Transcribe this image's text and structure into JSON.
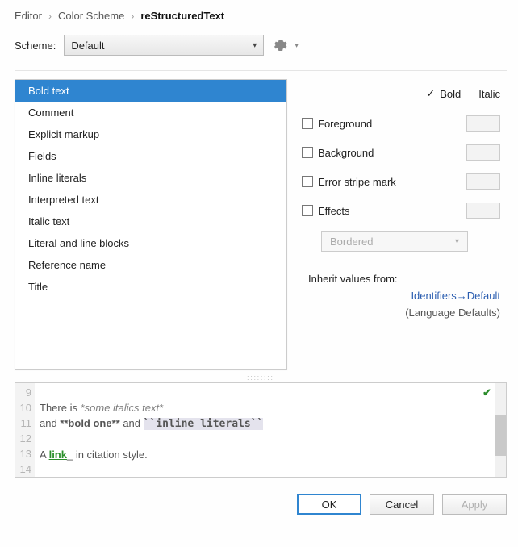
{
  "breadcrumb": {
    "a": "Editor",
    "b": "Color Scheme",
    "c": "reStructuredText"
  },
  "scheme": {
    "label": "Scheme:",
    "value": "Default"
  },
  "list": {
    "items": [
      "Bold text",
      "Comment",
      "Explicit markup",
      "Fields",
      "Inline literals",
      "Interpreted text",
      "Italic text",
      "Literal and line blocks",
      "Reference name",
      "Title"
    ],
    "selected_index": 0
  },
  "attrs": {
    "bold": {
      "label": "Bold",
      "checked": true
    },
    "italic": {
      "label": "Italic",
      "checked": false
    },
    "foreground": {
      "label": "Foreground",
      "checked": false
    },
    "background": {
      "label": "Background",
      "checked": false
    },
    "errorstripe": {
      "label": "Error stripe mark",
      "checked": false
    },
    "effects": {
      "label": "Effects",
      "checked": false,
      "value": "Bordered"
    }
  },
  "inherit": {
    "label": "Inherit values from:",
    "checked": false,
    "link": "Identifiers→Default",
    "sub": "(Language Defaults)"
  },
  "preview": {
    "lines": [
      "9",
      "10",
      "11",
      "12",
      "13",
      "14"
    ],
    "l10a": "There is ",
    "l10b": "*some italics text*",
    "l11a": "and ",
    "l11b": "**bold one**",
    "l11c": " and ",
    "l11d": "``inline literals``",
    "l13a": "A ",
    "l13b": "link",
    "l13c": "_",
    "l13d": " in citation style."
  },
  "buttons": {
    "ok": "OK",
    "cancel": "Cancel",
    "apply": "Apply"
  }
}
